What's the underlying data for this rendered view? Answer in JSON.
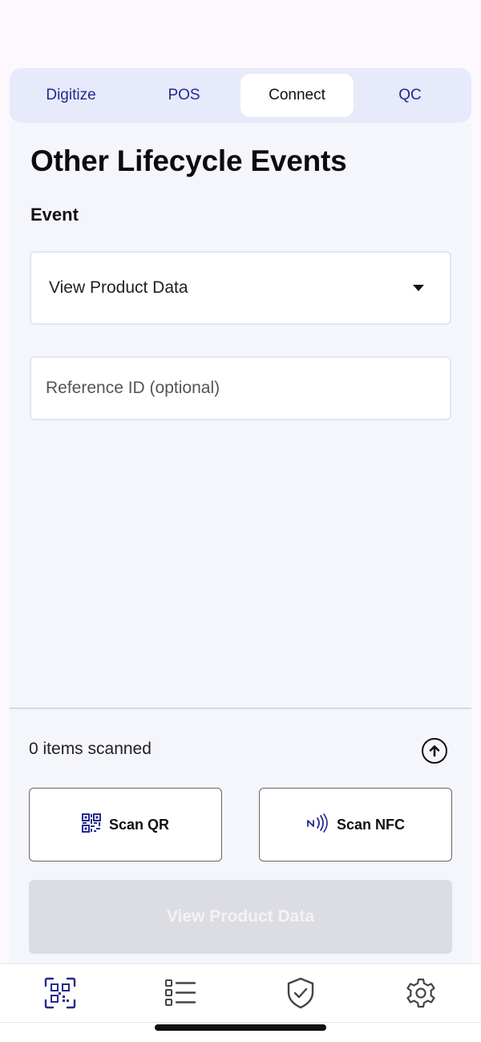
{
  "tabs": [
    {
      "label": "Digitize",
      "active": false
    },
    {
      "label": "POS",
      "active": false
    },
    {
      "label": "Connect",
      "active": true
    },
    {
      "label": "QC",
      "active": false
    }
  ],
  "page": {
    "title": "Other Lifecycle Events",
    "event_label": "Event"
  },
  "event_select": {
    "value": "View Product Data"
  },
  "reference_input": {
    "placeholder": "Reference ID (optional)",
    "value": ""
  },
  "scan": {
    "count_text": "0 items scanned",
    "scan_qr_label": "Scan QR",
    "scan_nfc_label": "Scan NFC",
    "submit_label": "View Product Data"
  },
  "icons": {
    "upload": "arrow-up-circle-icon",
    "qr": "qr-code-icon",
    "nfc": "nfc-icon",
    "nav_scan": "scan-frame-icon",
    "nav_list": "list-icon",
    "nav_shield": "shield-check-icon",
    "nav_settings": "gear-icon"
  },
  "colors": {
    "accent": "#24298f",
    "tab_bar_bg": "#e6eafa",
    "panel_bg": "#f5f6fc",
    "disabled_button": "#dcdde2"
  }
}
